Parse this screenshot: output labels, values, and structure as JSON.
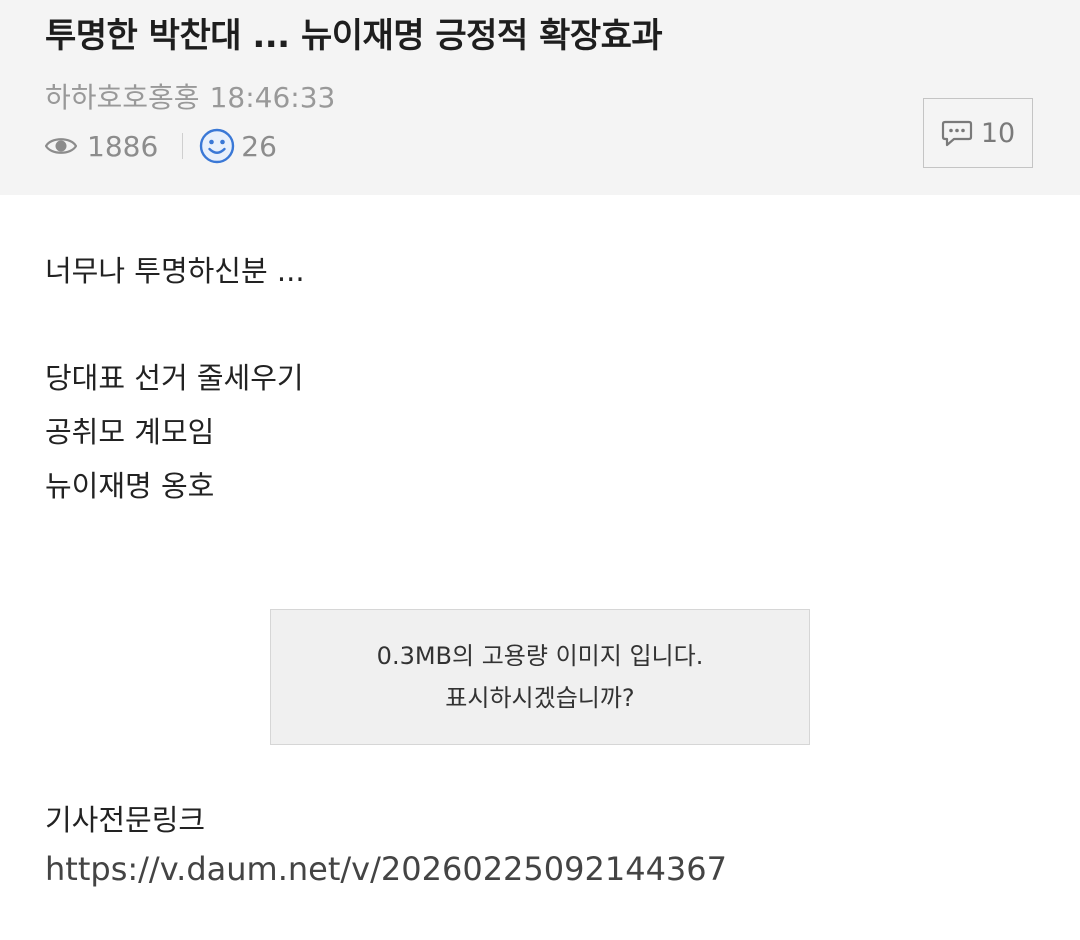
{
  "post": {
    "title": "투명한 박찬대 ... 뉴이재명 긍정적 확장효과",
    "author": "하하호호홍홍",
    "time": "18:46:33",
    "views": "1886",
    "likes": "26",
    "comment_count": "10"
  },
  "icons": {
    "views": "eye-icon",
    "likes": "smiley-icon",
    "comments": "speech-bubble-icon"
  },
  "colors": {
    "header_bg": "#f4f4f4",
    "smiley": "#3a78d6"
  },
  "content": {
    "line1": "너무나 투명하신분 ...",
    "line2": "당대표 선거 줄세우기",
    "line3": "공취모 계모임",
    "line4": "뉴이재명 옹호",
    "image_notice_line1": "0.3MB의 고용량 이미지 입니다.",
    "image_notice_line2": "표시하시겠습니까?",
    "link_label": "기사전문링크",
    "link_url": "https://v.daum.net/v/20260225092144367"
  }
}
